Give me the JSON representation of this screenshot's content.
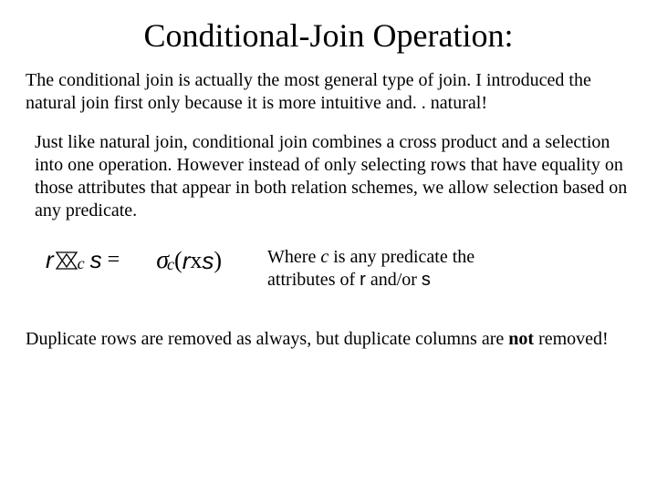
{
  "title": "Conditional-Join Operation:",
  "para1": "The conditional join is actually the most general type of join. I introduced the natural join first only because it is more intuitive and. . natural!",
  "para2": "Just like natural join, conditional join combines a cross product and a selection into one operation. However instead of only selecting rows that have equality on those attributes that appear in both relation schemes, we allow selection based on any predicate.",
  "formula": {
    "r": "r",
    "s": "s",
    "sub_c": "c",
    "equals": "=",
    "sigma": "σ",
    "open": "(",
    "x": " x ",
    "close": ")"
  },
  "explain": {
    "pre": "Where ",
    "c": "c",
    "mid": " is any predicate the attributes of ",
    "r": "r",
    "andor": " and/or ",
    "s": "s"
  },
  "para3_a": "Duplicate rows are removed as always, but duplicate columns are ",
  "para3_b": "not",
  "para3_c": " removed!"
}
